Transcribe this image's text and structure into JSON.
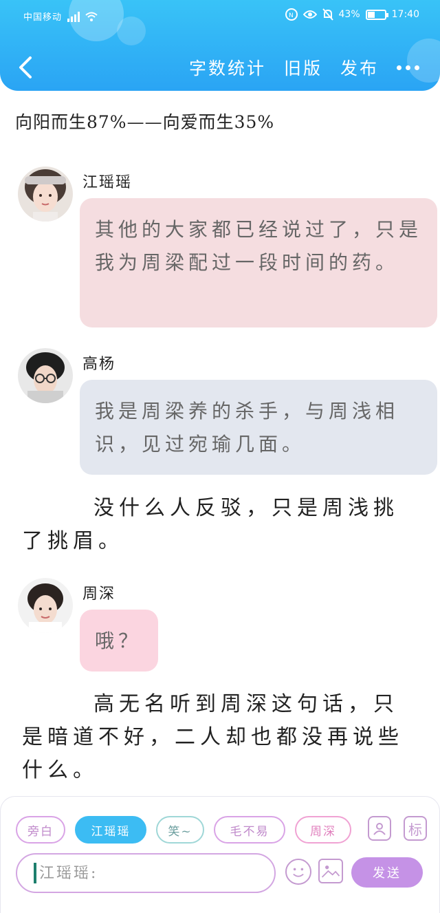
{
  "status_bar": {
    "carrier": "中国移动",
    "battery_percent": "43%",
    "battery_level": 0.43,
    "time": "17:40"
  },
  "header": {
    "word_count_label": "字数统计",
    "old_version_label": "旧版",
    "publish_label": "发布"
  },
  "story": {
    "title": "向阳而生87%——向爱而生35%",
    "messages": [
      {
        "speaker": "江瑶瑶",
        "text": "其他的大家都已经说过了，只是我为周梁配过一段时间的药。",
        "bubble_color": "#f5dde0"
      },
      {
        "speaker": "高杨",
        "text": "我是周梁养的杀手，与周浅相识，见过宛瑜几面。",
        "bubble_color": "#e3e7ef"
      },
      {
        "speaker": "周深",
        "text": "哦？",
        "bubble_color": "#fbd5e0"
      }
    ],
    "narration_1": "没什么人反驳，只是周浅挑了挑眉。",
    "narration_2": "高无名听到周深这句话，只是暗道不好，二人却也都没再说些什么。"
  },
  "toolbar": {
    "roles": [
      {
        "label": "旁白",
        "active": false
      },
      {
        "label": "江瑶瑶",
        "active": true
      },
      {
        "label": "笑~",
        "active": false
      },
      {
        "label": "毛不易",
        "active": false
      },
      {
        "label": "周深",
        "active": false
      }
    ],
    "tag_label": "标",
    "input_placeholder": "江瑶瑶:",
    "send_label": "发送"
  },
  "colors": {
    "header_gradient_top": "#39c3f7",
    "header_gradient_bottom": "#2aa4f4",
    "active_chip": "#3cbcf3",
    "send_button": "#c592e6"
  }
}
